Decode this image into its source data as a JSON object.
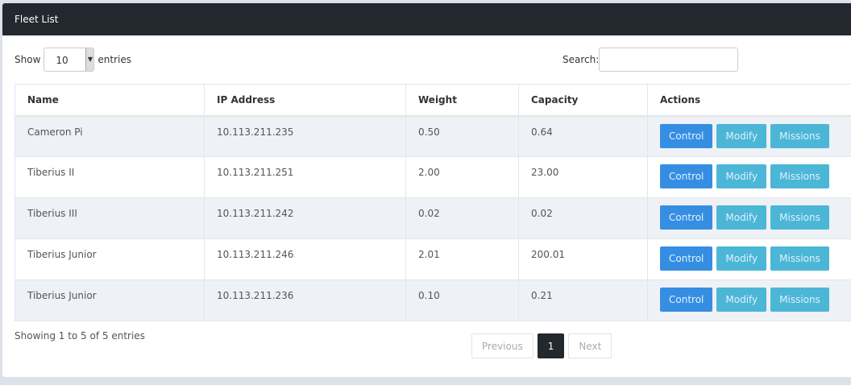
{
  "title": "Fleet List",
  "length": {
    "show": "Show",
    "value": "10",
    "entries": "entries"
  },
  "search": {
    "label": "Search:",
    "value": ""
  },
  "columns": [
    "Name",
    "IP Address",
    "Weight",
    "Capacity",
    "Actions"
  ],
  "rows": [
    {
      "name": "Cameron Pi",
      "ip": "10.113.211.235",
      "weight": "0.50",
      "capacity": "0.64"
    },
    {
      "name": "Tiberius II",
      "ip": "10.113.211.251",
      "weight": "2.00",
      "capacity": "23.00"
    },
    {
      "name": "Tiberius III",
      "ip": "10.113.211.242",
      "weight": "0.02",
      "capacity": "0.02"
    },
    {
      "name": "Tiberius Junior",
      "ip": "10.113.211.246",
      "weight": "2.01",
      "capacity": "200.01"
    },
    {
      "name": "Tiberius Junior",
      "ip": "10.113.211.236",
      "weight": "0.10",
      "capacity": "0.21"
    }
  ],
  "actions": {
    "control": "Control",
    "modify": "Modify",
    "missions": "Missions"
  },
  "info": "Showing 1 to 5 of 5 entries",
  "pagination": {
    "previous": "Previous",
    "current": "1",
    "next": "Next"
  }
}
